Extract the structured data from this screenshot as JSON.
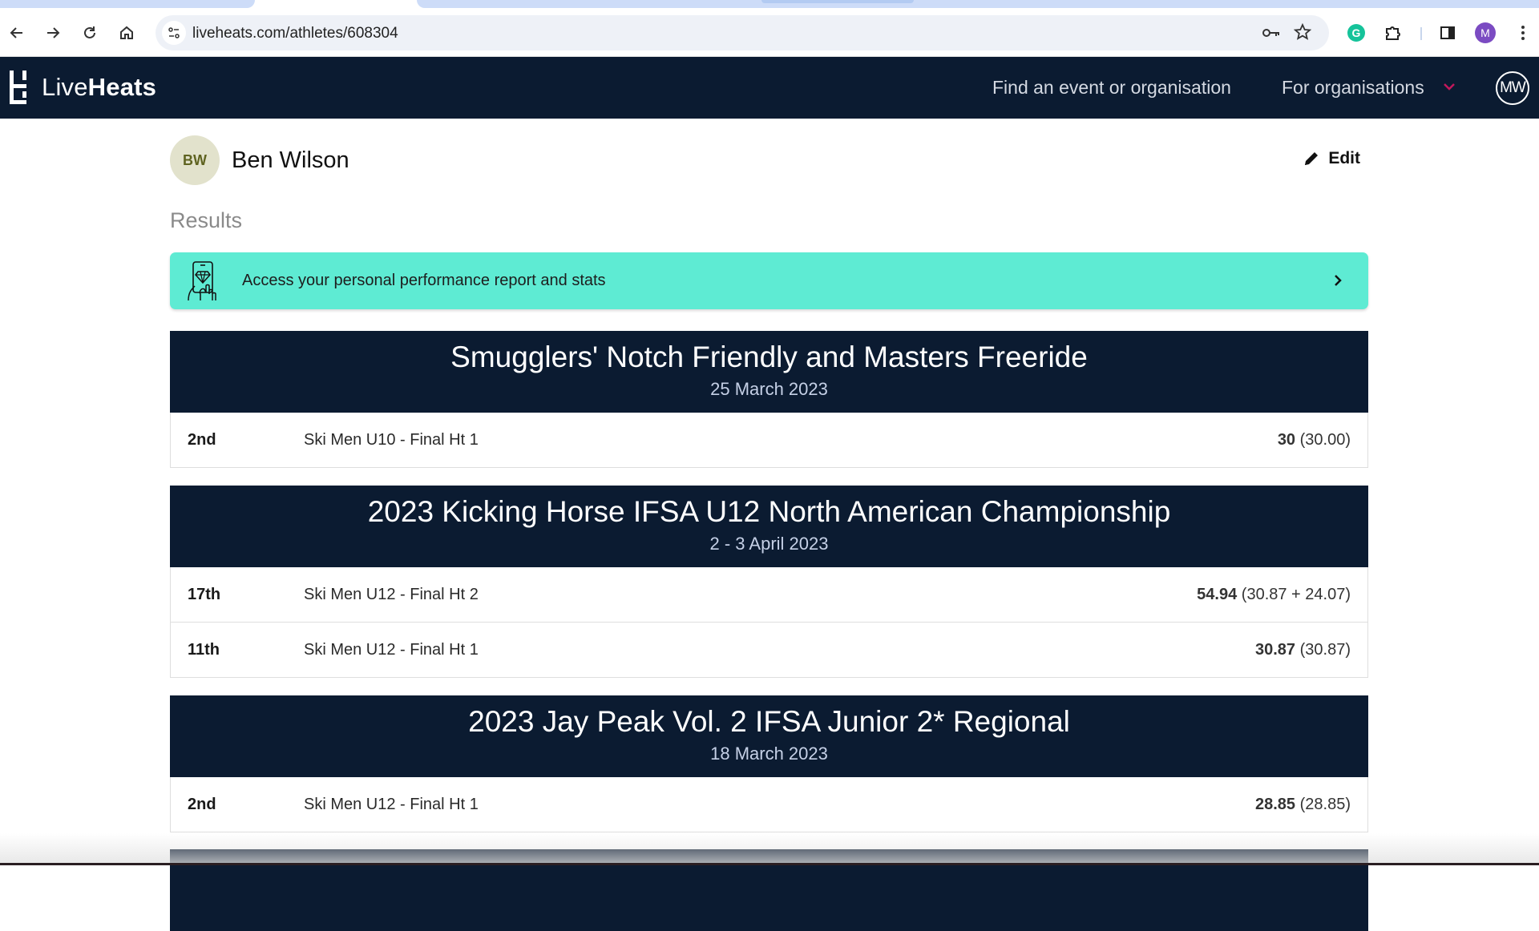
{
  "browser": {
    "url": "liveheats.com/athletes/608304",
    "profile_initial": "M",
    "grammarly_label": "G"
  },
  "navbar": {
    "logo_light": "Live",
    "logo_bold": "Heats",
    "find_link": "Find an event or organisation",
    "orgs_link": "For organisations",
    "user_initials": "MW",
    "accent_color": "#c2185b"
  },
  "athlete": {
    "initials": "BW",
    "name": "Ben Wilson",
    "edit_label": "Edit"
  },
  "results": {
    "heading": "Results",
    "banner_text": "Access your personal performance report and stats",
    "events": [
      {
        "title": "Smugglers' Notch Friendly and Masters Freeride",
        "date": "25 March 2023",
        "rows": [
          {
            "place": "2nd",
            "heat": "Ski Men U10 - Final Ht 1",
            "total": "30",
            "breakdown": "(30.00)"
          }
        ]
      },
      {
        "title": "2023 Kicking Horse IFSA U12 North American Championship",
        "date": "2 - 3 April 2023",
        "rows": [
          {
            "place": "17th",
            "heat": "Ski Men U12 - Final Ht 2",
            "total": "54.94",
            "breakdown": "(30.87 + 24.07)"
          },
          {
            "place": "11th",
            "heat": "Ski Men U12 - Final Ht 1",
            "total": "30.87",
            "breakdown": "(30.87)"
          }
        ]
      },
      {
        "title": "2023 Jay Peak Vol. 2 IFSA Junior 2* Regional",
        "date": "18 March 2023",
        "rows": [
          {
            "place": "2nd",
            "heat": "Ski Men U12 - Final Ht 1",
            "total": "28.85",
            "breakdown": "(28.85)"
          }
        ]
      }
    ]
  },
  "colors": {
    "navbar_bg": "#0b1b31",
    "banner_bg": "#5eebd3",
    "avatar_bg": "#e2e2cc"
  }
}
